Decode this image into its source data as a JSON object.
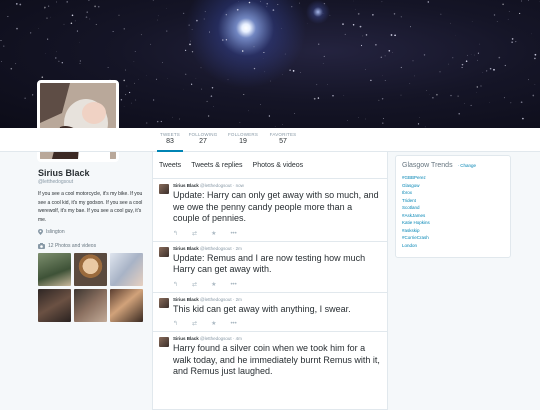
{
  "banner": {
    "description_icon": "starfield-banner"
  },
  "stats": [
    {
      "label": "TWEETS",
      "value": "83"
    },
    {
      "label": "FOLLOWING",
      "value": "27"
    },
    {
      "label": "FOLLOWERS",
      "value": "19"
    },
    {
      "label": "FAVORITES",
      "value": "57"
    }
  ],
  "profile": {
    "name": "Sirius Black",
    "handle": "@letthedogsout",
    "bio": "If you see a cool motorcycle, it's my bike. If you see a cool kid, it's my godson. If you see a cool werewolf, it's my bae. If you see a cool guy, it's me.",
    "location": "Islington",
    "media_label": "12 Photos and videos"
  },
  "timeline": {
    "tabs": [
      "Tweets",
      "Tweets & replies",
      "Photos & videos"
    ],
    "tweets": [
      {
        "name": "Sirius Black",
        "handle": "@letthedogsout",
        "time": "· now",
        "text": "Update: Harry can only get away with so much, and we owe the penny candy people more than a couple of pennies."
      },
      {
        "name": "Sirius Black",
        "handle": "@letthedogsout",
        "time": "· 2m",
        "text": "Update: Remus and I are now testing how much Harry can get away with."
      },
      {
        "name": "Sirius Black",
        "handle": "@letthedogsout",
        "time": "· 2m",
        "text": "This kid can get away with anything, I swear."
      },
      {
        "name": "Sirius Black",
        "handle": "@letthedogsout",
        "time": "· 4m",
        "text": "Harry found a silver coin when we took him for a walk today, and he immediately burnt Remus with it, and Remus just laughed."
      }
    ],
    "action_icons": [
      "reply-icon",
      "retweet-icon",
      "favorite-icon",
      "more-icon"
    ]
  },
  "trends": {
    "title": "Glasgow Trends",
    "change_label": "· Change",
    "items": [
      "#GBBPerez",
      "Glasgow",
      "Ibrox",
      "Trident",
      "Scotland",
      "#AskJames",
      "Katie Hopkins",
      "#askskip",
      "#CorrieCrash",
      "London"
    ]
  },
  "colors": {
    "accent": "#0084b4",
    "background": "#f5f8fa",
    "muted": "#8899a6"
  }
}
